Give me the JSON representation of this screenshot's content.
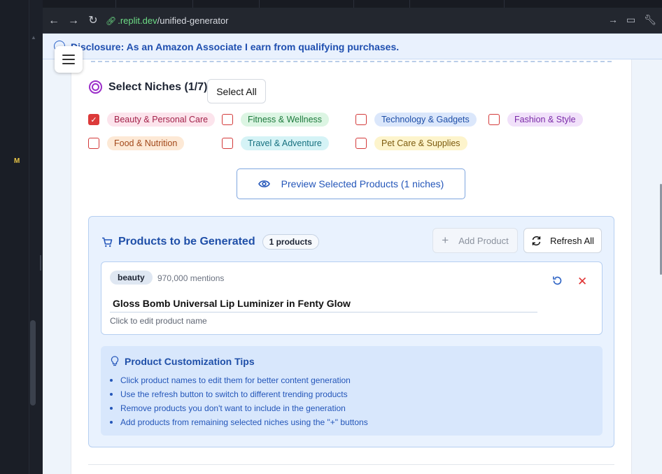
{
  "browser": {
    "url_host": ".replit.dev",
    "url_path": "/unified-generator"
  },
  "ide": {
    "side_label": "M"
  },
  "disclosure": {
    "text": "Disclosure: As an Amazon Associate I earn from qualifying purchases."
  },
  "niches": {
    "title": "Select Niches (1/7)",
    "select_all_label": "Select All",
    "items": [
      {
        "label": "Beauty & Personal Care",
        "checked": true,
        "bg": "#fce4ec",
        "color": "#a3224a"
      },
      {
        "label": "Fitness & Wellness",
        "checked": false,
        "bg": "#dcf5e3",
        "color": "#1d7a3d"
      },
      {
        "label": "Technology & Gadgets",
        "checked": false,
        "bg": "#dbe7fb",
        "color": "#1f4fa8"
      },
      {
        "label": "Fashion & Style",
        "checked": false,
        "bg": "#f1e1fa",
        "color": "#7a2aa8"
      },
      {
        "label": "Food & Nutrition",
        "checked": false,
        "bg": "#fde9d6",
        "color": "#a2481a"
      },
      {
        "label": "Travel & Adventure",
        "checked": false,
        "bg": "#d5f3f6",
        "color": "#16707f"
      },
      {
        "label": "Pet Care & Supplies",
        "checked": false,
        "bg": "#fdf4cc",
        "color": "#7d5b0f"
      }
    ],
    "preview_label": "Preview Selected Products (1 niches)"
  },
  "products": {
    "title": "Products to be Generated",
    "count_label": "1 products",
    "add_label": "Add Product",
    "refresh_label": "Refresh All",
    "items": [
      {
        "category": "beauty",
        "mentions": "970,000 mentions",
        "name": "Gloss Bomb Universal Lip Luminizer in Fenty Glow",
        "hint": "Click to edit product name"
      }
    ]
  },
  "tips": {
    "title": "Product Customization Tips",
    "items": [
      "Click product names to edit them for better content generation",
      "Use the refresh button to switch to different trending products",
      "Remove products you don't want to include in the generation",
      "Add products from remaining selected niches using the \"+\" buttons"
    ]
  }
}
